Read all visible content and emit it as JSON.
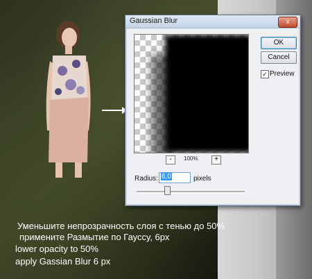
{
  "dialog": {
    "title": "Gaussian Blur",
    "close_glyph": "x",
    "ok_label": "OK",
    "cancel_label": "Cancel",
    "preview_label": "Preview",
    "preview_checked": true,
    "zoom_out_glyph": "-",
    "zoom_in_glyph": "+",
    "zoom_level": "100%",
    "radius_label": "Radius:",
    "radius_value": "6,0",
    "pixels_label": "pixels",
    "slider_value_fraction": 0.28
  },
  "captions": {
    "ru_line1": "Уменьшите непрозрачность слоя с тенью до 50%",
    "ru_line2": "примените Размытие по Гауссу, 6px",
    "en_line1": "lower opacity to 50%",
    "en_line2": "apply Gassian Blur 6 px"
  },
  "colors": {
    "caption": "#ffffff",
    "accent": "#3399ff"
  }
}
